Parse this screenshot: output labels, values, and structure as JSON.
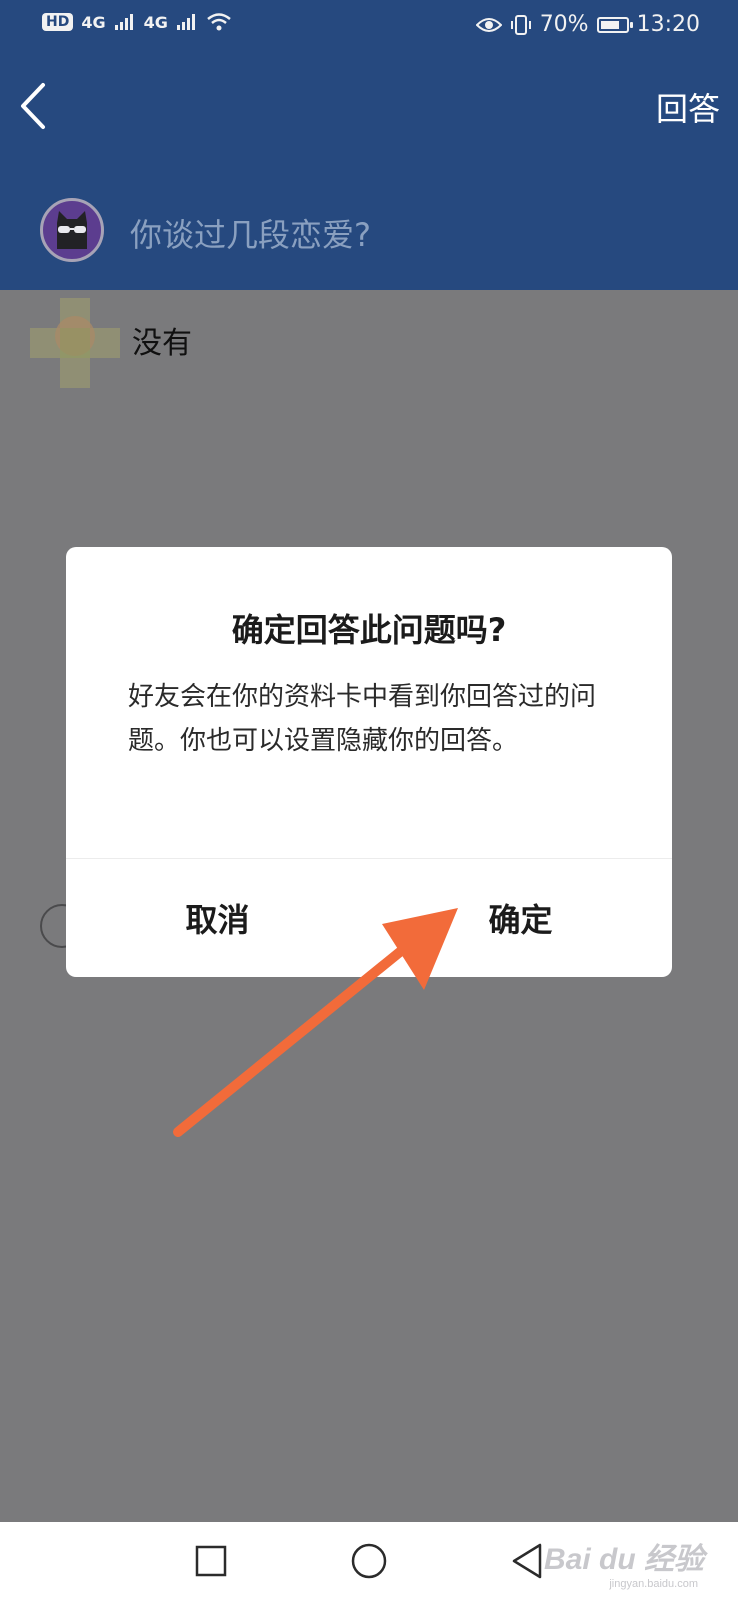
{
  "status_bar": {
    "left_badge": "HD",
    "network1": "4G",
    "network2": "4G",
    "battery": "70%",
    "time": "13:20"
  },
  "header": {
    "action_label": "回答"
  },
  "question": {
    "text": "你谈过几段恋爱?"
  },
  "answer": {
    "text": "没有"
  },
  "dialog": {
    "title": "确定回答此问题吗?",
    "body": "好友会在你的资料卡中看到你回答过的问题。你也可以设置隐藏你的回答。",
    "cancel_label": "取消",
    "confirm_label": "确定"
  },
  "watermark": {
    "text": "Bai du 经验",
    "sub": "jingyan.baidu.com"
  },
  "colors": {
    "header_blue": "#26497f",
    "overlay_gray": "#7a7a7c",
    "arrow_orange": "#f26b3a"
  }
}
